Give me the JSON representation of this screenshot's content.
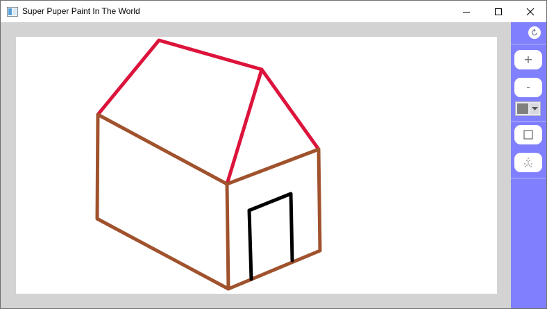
{
  "window": {
    "title": "Super Puper Paint In The World",
    "controls": [
      "minimize",
      "maximize",
      "close"
    ]
  },
  "colors": {
    "titlebar": "#ffffff",
    "workspace": "#d3d3d3",
    "canvas": "#ffffff",
    "toolbar": "#8080ff",
    "roof_stroke": "#dc143c",
    "wall_stroke": "#a0522d",
    "door_stroke": "#000000",
    "selected_color": "#808080"
  },
  "toolbar": {
    "refresh_icon": "refresh-icon",
    "zoom_in_label": "+",
    "zoom_out_label": "-",
    "color_picker": {
      "selected": "#808080",
      "arrow_icon": "chevron-down-icon"
    },
    "rectangle_icon": "square-icon",
    "spray_icon": "spray-icon"
  },
  "drawing": {
    "strokes": [
      {
        "part": "roof-left",
        "color": "#dc143c"
      },
      {
        "part": "roof-right",
        "color": "#dc143c"
      },
      {
        "part": "walls",
        "color": "#a0522d"
      },
      {
        "part": "door",
        "color": "#000000"
      }
    ]
  }
}
